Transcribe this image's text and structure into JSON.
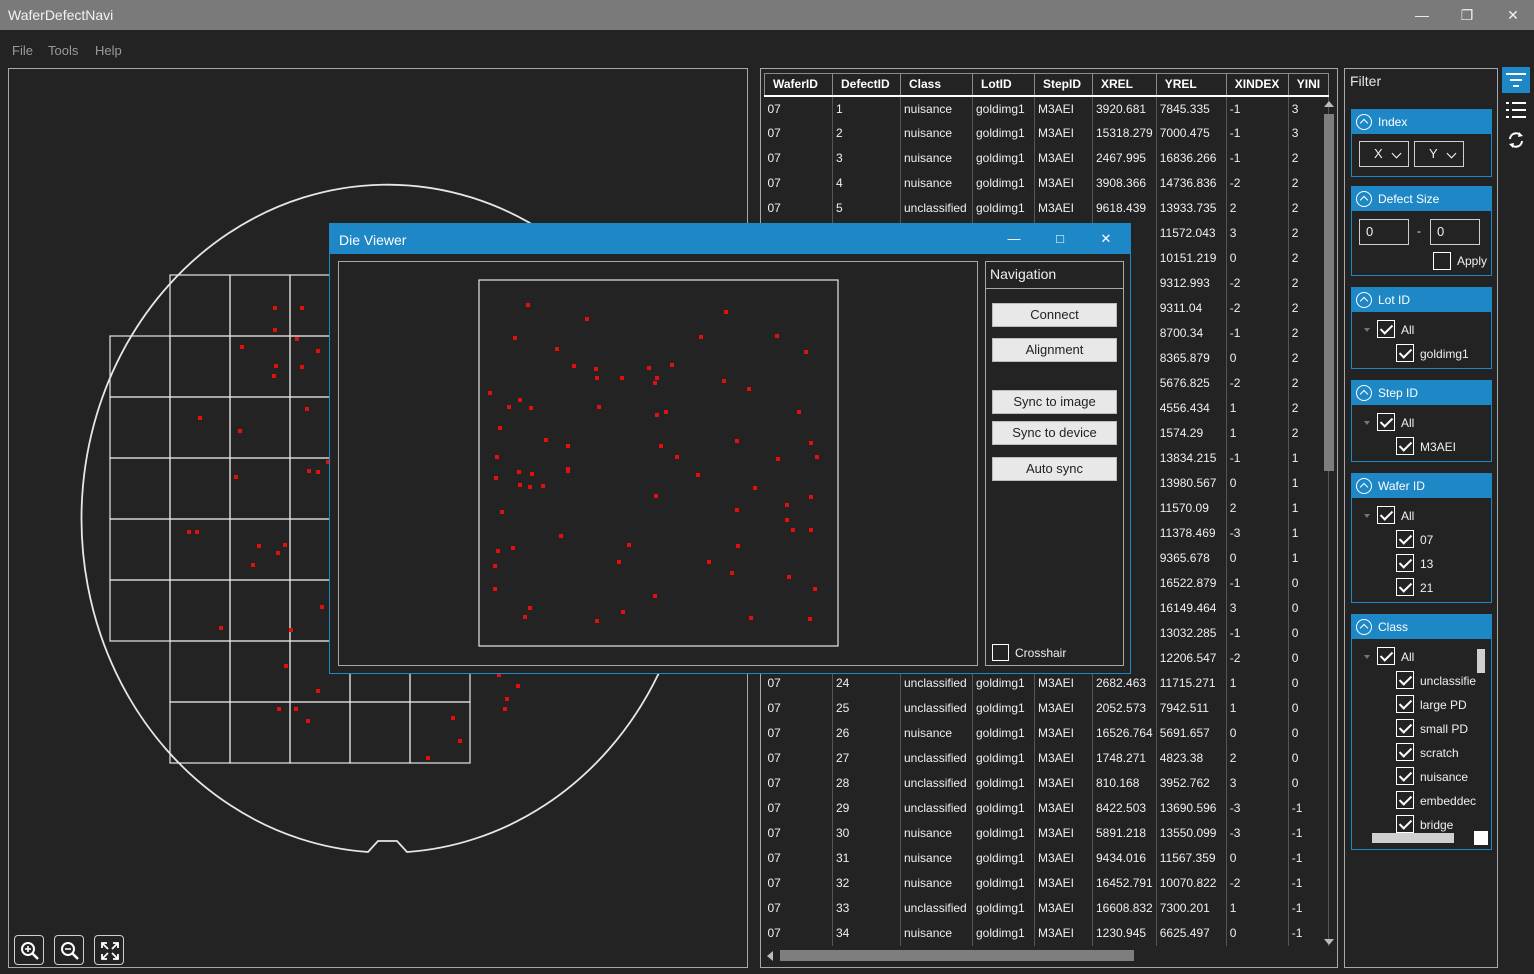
{
  "app": {
    "title": "WaferDefectNavi"
  },
  "menu": [
    "File",
    "Tools",
    "Help"
  ],
  "table": {
    "columns": [
      "WaferID",
      "DefectID",
      "Class",
      "LotID",
      "StepID",
      "XREL",
      "YREL",
      "XINDEX",
      "YINI"
    ],
    "rows": [
      [
        "07",
        "1",
        "nuisance",
        "goldimg1",
        "M3AEI",
        "3920.681",
        "7845.335",
        "-1",
        "3"
      ],
      [
        "07",
        "2",
        "nuisance",
        "goldimg1",
        "M3AEI",
        "15318.279",
        "7000.475",
        "-1",
        "3"
      ],
      [
        "07",
        "3",
        "nuisance",
        "goldimg1",
        "M3AEI",
        "2467.995",
        "16836.266",
        "-1",
        "2"
      ],
      [
        "07",
        "4",
        "nuisance",
        "goldimg1",
        "M3AEI",
        "3908.366",
        "14736.836",
        "-2",
        "2"
      ],
      [
        "07",
        "5",
        "unclassified",
        "goldimg1",
        "M3AEI",
        "9618.439",
        "13933.735",
        "2",
        "2"
      ],
      [
        "07",
        "6",
        "",
        "",
        "",
        "",
        "11572.043",
        "3",
        "2"
      ],
      [
        "07",
        "7",
        "",
        "",
        "",
        "",
        "10151.219",
        "0",
        "2"
      ],
      [
        "07",
        "8",
        "",
        "",
        "",
        "",
        "9312.993",
        "-2",
        "2"
      ],
      [
        "07",
        "9",
        "",
        "",
        "",
        "",
        "9311.04",
        "-2",
        "2"
      ],
      [
        "07",
        "10",
        "",
        "",
        "",
        "",
        "8700.34",
        "-1",
        "2"
      ],
      [
        "07",
        "11",
        "",
        "",
        "",
        "",
        "8365.879",
        "0",
        "2"
      ],
      [
        "07",
        "12",
        "",
        "",
        "",
        "",
        "5676.825",
        "-2",
        "2"
      ],
      [
        "07",
        "13",
        "",
        "",
        "",
        "",
        "4556.434",
        "1",
        "2"
      ],
      [
        "07",
        "14",
        "",
        "",
        "",
        "",
        "1574.29",
        "1",
        "2"
      ],
      [
        "07",
        "15",
        "",
        "",
        "",
        "",
        "13834.215",
        "-1",
        "1"
      ],
      [
        "07",
        "16",
        "",
        "",
        "",
        "",
        "13980.567",
        "0",
        "1"
      ],
      [
        "07",
        "17",
        "",
        "",
        "",
        "",
        "11570.09",
        "2",
        "1"
      ],
      [
        "07",
        "18",
        "",
        "",
        "",
        "",
        "11378.469",
        "-3",
        "1"
      ],
      [
        "07",
        "19",
        "",
        "",
        "",
        "",
        "9365.678",
        "0",
        "1"
      ],
      [
        "07",
        "20",
        "",
        "",
        "",
        "",
        "16522.879",
        "-1",
        "0"
      ],
      [
        "07",
        "21",
        "",
        "",
        "",
        "",
        "16149.464",
        "3",
        "0"
      ],
      [
        "07",
        "22",
        "",
        "",
        "",
        "",
        "13032.285",
        "-1",
        "0"
      ],
      [
        "07",
        "23",
        "",
        "",
        "",
        "",
        "12206.547",
        "-2",
        "0"
      ],
      [
        "07",
        "24",
        "unclassified",
        "goldimg1",
        "M3AEI",
        "2682.463",
        "11715.271",
        "1",
        "0"
      ],
      [
        "07",
        "25",
        "unclassified",
        "goldimg1",
        "M3AEI",
        "2052.573",
        "7942.511",
        "1",
        "0"
      ],
      [
        "07",
        "26",
        "nuisance",
        "goldimg1",
        "M3AEI",
        "16526.764",
        "5691.657",
        "0",
        "0"
      ],
      [
        "07",
        "27",
        "unclassified",
        "goldimg1",
        "M3AEI",
        "1748.271",
        "4823.38",
        "2",
        "0"
      ],
      [
        "07",
        "28",
        "unclassified",
        "goldimg1",
        "M3AEI",
        "810.168",
        "3952.762",
        "3",
        "0"
      ],
      [
        "07",
        "29",
        "unclassified",
        "goldimg1",
        "M3AEI",
        "8422.503",
        "13690.596",
        "-3",
        "-1"
      ],
      [
        "07",
        "30",
        "nuisance",
        "goldimg1",
        "M3AEI",
        "5891.218",
        "13550.099",
        "-3",
        "-1"
      ],
      [
        "07",
        "31",
        "nuisance",
        "goldimg1",
        "M3AEI",
        "9434.016",
        "11567.359",
        "0",
        "-1"
      ],
      [
        "07",
        "32",
        "nuisance",
        "goldimg1",
        "M3AEI",
        "16452.791",
        "10070.822",
        "-2",
        "-1"
      ],
      [
        "07",
        "33",
        "unclassified",
        "goldimg1",
        "M3AEI",
        "16608.832",
        "7300.201",
        "1",
        "-1"
      ],
      [
        "07",
        "34",
        "nuisance",
        "goldimg1",
        "M3AEI",
        "1230.945",
        "6625.497",
        "0",
        "-1"
      ]
    ]
  },
  "filter": {
    "title": "Filter",
    "index": {
      "label": "Index",
      "x": "X",
      "y": "Y"
    },
    "defect_size": {
      "label": "Defect Size",
      "min": "0",
      "sep": "-",
      "max": "0",
      "apply": "Apply"
    },
    "lot": {
      "label": "Lot ID",
      "all": "All",
      "items": [
        "goldimg1"
      ]
    },
    "step": {
      "label": "Step ID",
      "all": "All",
      "items": [
        "M3AEI"
      ]
    },
    "wafer": {
      "label": "Wafer ID",
      "all": "All",
      "items": [
        "07",
        "13",
        "21"
      ]
    },
    "class": {
      "label": "Class",
      "all": "All",
      "items": [
        "unclassifie",
        "large PD",
        "small PD",
        "scratch",
        "nuisance",
        "embeddec",
        "bridge"
      ]
    }
  },
  "die_viewer": {
    "title": "Die Viewer",
    "nav_title": "Navigation",
    "buttons": [
      "Connect",
      "Alignment",
      "Sync to image",
      "Sync to device",
      "Auto sync"
    ],
    "crosshair": "Crosshair"
  },
  "colors": {
    "accent": "#1e88c7",
    "defect": "#e01010",
    "background": "#232323"
  },
  "icons": [
    "zoom-in-icon",
    "zoom-out-icon",
    "fit-to-screen-icon",
    "filter-icon",
    "list-icon",
    "refresh-icon"
  ]
}
